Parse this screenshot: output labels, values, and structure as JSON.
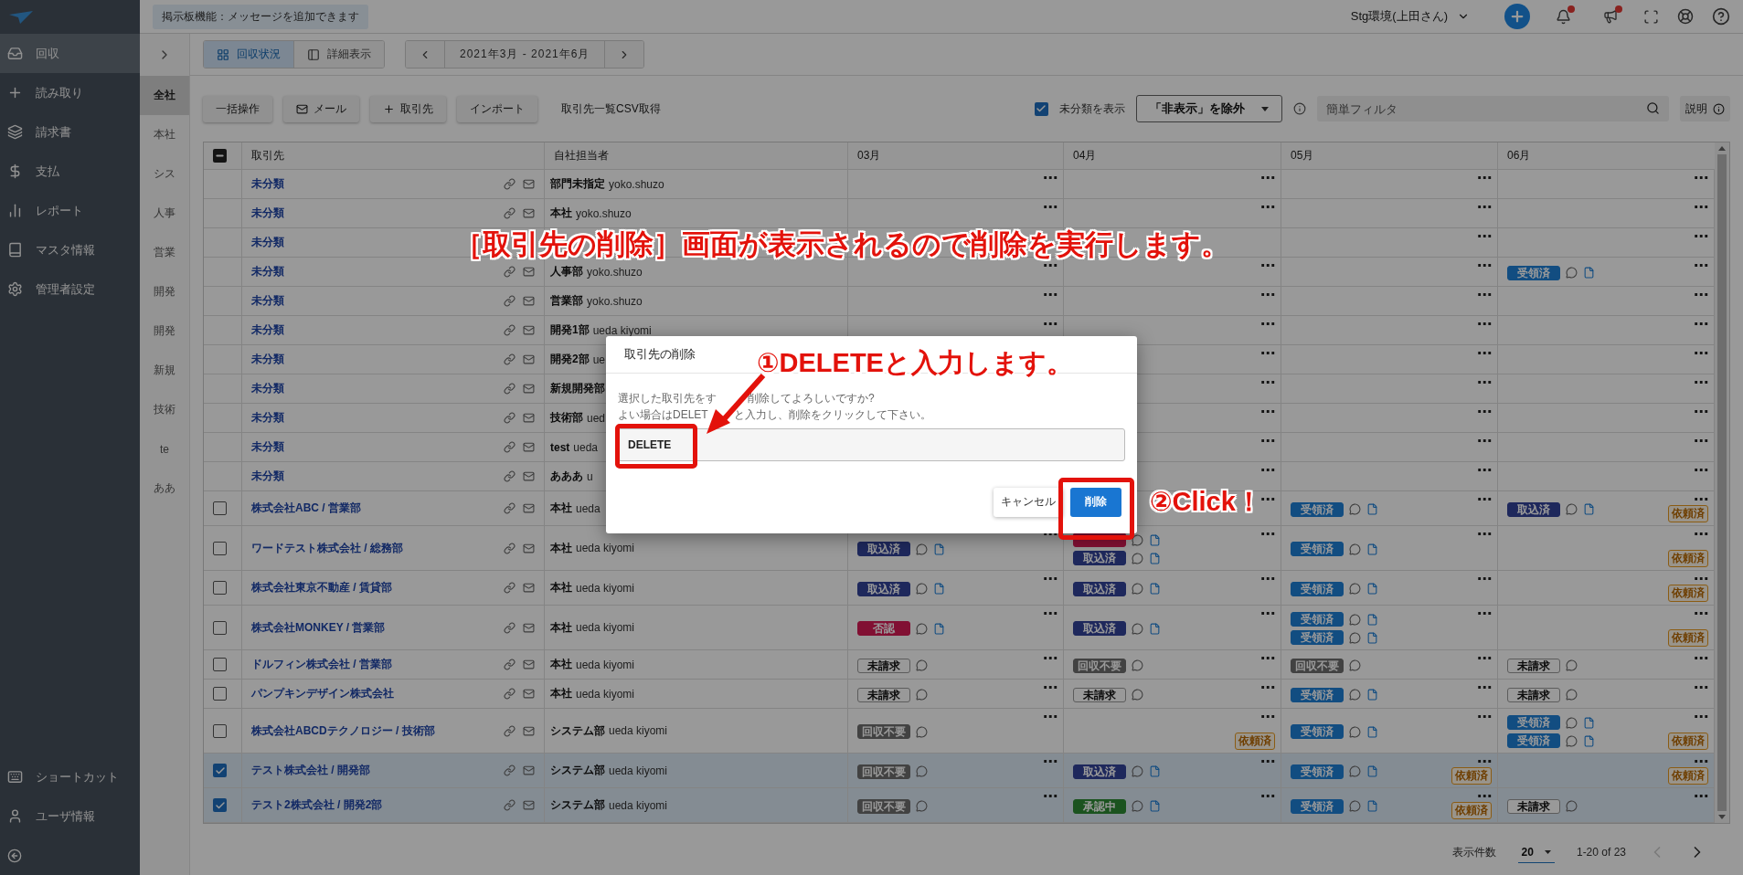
{
  "sidebar": {
    "items": [
      {
        "label": "回収",
        "selected": true
      },
      {
        "label": "読み取り",
        "selected": false
      },
      {
        "label": "請求書",
        "selected": false
      },
      {
        "label": "支払",
        "selected": false
      },
      {
        "label": "レポート",
        "selected": false
      },
      {
        "label": "マスタ情報",
        "selected": false
      },
      {
        "label": "管理者設定",
        "selected": false
      }
    ],
    "bottom_items": [
      "ショートカット",
      "ユーザ情報"
    ]
  },
  "top_bar": {
    "notice": "掲示板機能：メッセージを追加できます",
    "environment": "Stg環境(上田さん)",
    "notifications_unread": true,
    "announcements_unread": true
  },
  "view_tabs": [
    {
      "label": "回収状況",
      "selected": true
    },
    {
      "label": "詳細表示",
      "selected": false
    }
  ],
  "period": "2021年3月 - 2021年6月",
  "subnav": {
    "items": [
      {
        "label": "全社",
        "selected": true
      },
      {
        "label": "本社",
        "selected": false
      },
      {
        "label": "シス",
        "selected": false
      },
      {
        "label": "人事",
        "selected": false
      },
      {
        "label": "営業",
        "selected": false
      },
      {
        "label": "開発",
        "selected": false
      },
      {
        "label": "開発",
        "selected": false
      },
      {
        "label": "新規",
        "selected": false
      },
      {
        "label": "技術",
        "selected": false
      },
      {
        "label": "te",
        "selected": false
      },
      {
        "label": "ああ",
        "selected": false
      }
    ]
  },
  "actions": [
    "一括操作",
    "メール",
    "取引先",
    "インポート"
  ],
  "csv_link": "取引先一覧CSV取得",
  "show_unclassified": {
    "label": "未分類を表示",
    "checked": true
  },
  "visibility_filter": "「非表示」を除外",
  "filter": {
    "placeholder": "簡単フィルタ"
  },
  "help_button": "説明",
  "table": {
    "header_checkbox": {
      "partial": true
    },
    "columns": [
      "取引先",
      "自社担当者",
      "03月",
      "04月",
      "05月",
      "06月"
    ],
    "rows": [
      {
        "kind": "group",
        "name": "未分類",
        "department": "部門未指定",
        "person": "yoko.shuzo",
        "months": [
          {
            "menu": "⋯"
          },
          {
            "menu": "⋯"
          },
          {
            "menu": "⋯"
          },
          {
            "menu": "⋯"
          }
        ]
      },
      {
        "kind": "group",
        "name": "未分類",
        "department": "本社",
        "person": "yoko.shuzo",
        "months": [
          {
            "menu": "⋯"
          },
          {
            "menu": "⋯"
          },
          {
            "menu": "⋯"
          },
          {
            "menu": "⋯"
          }
        ]
      },
      {
        "kind": "group",
        "name": "未分類",
        "months": [
          {
            "menu": "⋯"
          },
          {
            "menu": "⋯"
          }
        ]
      },
      {
        "kind": "group",
        "name": "未分類",
        "department": "人事部",
        "person": "yoko.shuzo",
        "months": [
          {
            "menu": "⋯"
          },
          {
            "menu": "⋯"
          },
          {
            "menu": "⋯"
          },
          {
            "menu": "⋯",
            "statuses": [
              {
                "label": "受領済",
                "kind": "received"
              }
            ]
          }
        ]
      },
      {
        "kind": "group",
        "name": "未分類",
        "department": "営業部",
        "person": "yoko.shuzo",
        "months": [
          {
            "menu": "⋯"
          },
          {
            "menu": "⋯"
          },
          {
            "menu": "⋯"
          },
          {
            "menu": "⋯"
          }
        ]
      },
      {
        "kind": "group",
        "name": "未分類",
        "department": "開発1部",
        "person": "ueda kiyomi",
        "months": [
          {
            "menu": "⋯"
          },
          {
            "menu": "⋯"
          },
          {
            "menu": "⋯"
          },
          {
            "menu": "⋯"
          }
        ]
      },
      {
        "kind": "group",
        "name": "未分類",
        "department": "開発2部",
        "person": "ue",
        "months": [
          {
            "menu": "⋯"
          },
          {
            "menu": "⋯"
          },
          {
            "menu": "⋯"
          }
        ]
      },
      {
        "kind": "group",
        "name": "未分類",
        "department": "新規開発部",
        "months": [
          {
            "menu": "⋯"
          },
          {
            "menu": "⋯"
          },
          {
            "menu": "⋯"
          }
        ]
      },
      {
        "kind": "group",
        "name": "未分類",
        "department": "技術部",
        "person": "ued",
        "months": [
          {
            "menu": "⋯"
          },
          {
            "menu": "⋯"
          },
          {
            "menu": "⋯"
          }
        ]
      },
      {
        "kind": "group",
        "name": "未分類",
        "department": "test",
        "person": "ueda",
        "months": [
          {
            "menu": "⋯"
          },
          {
            "menu": "⋯"
          },
          {
            "menu": "⋯"
          }
        ]
      },
      {
        "kind": "group",
        "name": "未分類",
        "department": "あああ",
        "person": "u",
        "months": [
          {
            "menu": "⋯"
          },
          {
            "menu": "⋯"
          },
          {
            "menu": "⋯"
          }
        ]
      },
      {
        "kind": "partner",
        "checked": false,
        "name": "株式会社ABC / 営業部",
        "department": "本社",
        "person": "ueda",
        "months": [
          {
            "menu": "⋯"
          },
          {
            "menu": "⋯",
            "statuses": [
              {
                "label": "受領済",
                "kind": "received"
              }
            ]
          },
          {
            "menu": "⋯",
            "statuses": [
              {
                "label": "取込済",
                "kind": "imported"
              }
            ],
            "request_label": "依頼済"
          }
        ]
      },
      {
        "kind": "partner",
        "checked": false,
        "name": "ワードテスト株式会社 / 総務部",
        "department": "本社",
        "person": "ueda kiyomi",
        "months": [
          {
            "menu": "⋯",
            "statuses": [
              {
                "label": "取込済",
                "kind": "imported"
              }
            ]
          },
          {
            "menu": "⋯",
            "statuses": [
              {
                "kind": "rejected"
              },
              {
                "label": "取込済",
                "kind": "imported"
              }
            ]
          },
          {
            "menu": "⋯",
            "statuses": [
              {
                "label": "受領済",
                "kind": "received"
              }
            ]
          },
          {
            "menu": "⋯",
            "request_label": "依頼済"
          }
        ]
      },
      {
        "kind": "partner",
        "checked": false,
        "name": "株式会社東京不動産 / 賃貸部",
        "department": "本社",
        "person": "ueda kiyomi",
        "months": [
          {
            "menu": "⋯",
            "statuses": [
              {
                "label": "取込済",
                "kind": "imported"
              }
            ]
          },
          {
            "menu": "⋯",
            "statuses": [
              {
                "label": "取込済",
                "kind": "imported"
              }
            ]
          },
          {
            "menu": "⋯",
            "statuses": [
              {
                "label": "受領済",
                "kind": "received"
              }
            ]
          },
          {
            "menu": "⋯",
            "request_label": "依頼済"
          }
        ]
      },
      {
        "kind": "partner",
        "checked": false,
        "name": "株式会社MONKEY / 営業部",
        "department": "本社",
        "person": "ueda kiyomi",
        "months": [
          {
            "menu": "⋯",
            "statuses": [
              {
                "label": "否認",
                "kind": "rejected"
              }
            ]
          },
          {
            "menu": "⋯",
            "statuses": [
              {
                "label": "取込済",
                "kind": "imported"
              }
            ]
          },
          {
            "menu": "⋯",
            "statuses": [
              {
                "label": "受領済",
                "kind": "received"
              },
              {
                "label": "受領済",
                "kind": "received"
              }
            ]
          },
          {
            "menu": "⋯",
            "request_label": "依頼済"
          }
        ]
      },
      {
        "kind": "partner",
        "checked": false,
        "name": "ドルフィン株式会社 / 営業部",
        "department": "本社",
        "person": "ueda kiyomi",
        "months": [
          {
            "menu": "⋯",
            "statuses": [
              {
                "label": "未請求",
                "kind": "unbilled"
              }
            ]
          },
          {
            "menu": "⋯",
            "statuses": [
              {
                "label": "回収不要",
                "kind": "unneeded"
              }
            ]
          },
          {
            "menu": "⋯",
            "statuses": [
              {
                "label": "回収不要",
                "kind": "unneeded"
              }
            ]
          },
          {
            "menu": "⋯",
            "statuses": [
              {
                "label": "未請求",
                "kind": "unbilled"
              }
            ]
          }
        ]
      },
      {
        "kind": "partner",
        "checked": false,
        "name": "パンプキンデザイン株式会社",
        "department": "本社",
        "person": "ueda kiyomi",
        "months": [
          {
            "menu": "⋯",
            "statuses": [
              {
                "label": "未請求",
                "kind": "unbilled"
              }
            ]
          },
          {
            "menu": "⋯",
            "statuses": [
              {
                "label": "未請求",
                "kind": "unbilled"
              }
            ]
          },
          {
            "menu": "⋯",
            "statuses": [
              {
                "label": "受領済",
                "kind": "received"
              }
            ]
          },
          {
            "menu": "⋯",
            "statuses": [
              {
                "label": "未請求",
                "kind": "unbilled"
              }
            ]
          }
        ]
      },
      {
        "kind": "partner",
        "checked": false,
        "name": "株式会社ABCDテクノロジー / 技術部",
        "department": "システム部",
        "person": "ueda kiyomi",
        "months": [
          {
            "menu": "⋯",
            "statuses": [
              {
                "label": "回収不要",
                "kind": "unneeded"
              }
            ]
          },
          {
            "menu": "⋯",
            "request_label": "依頼済"
          },
          {
            "menu": "⋯",
            "statuses": [
              {
                "label": "受領済",
                "kind": "received"
              }
            ]
          },
          {
            "menu": "⋯",
            "statuses": [
              {
                "label": "受領済",
                "kind": "received"
              },
              {
                "label": "受領済",
                "kind": "received"
              }
            ],
            "request_label": "依頼済"
          }
        ]
      },
      {
        "kind": "partner",
        "checked": true,
        "name": "テスト株式会社 / 開発部",
        "department": "システム部",
        "person": "ueda kiyomi",
        "months": [
          {
            "menu": "⋯",
            "statuses": [
              {
                "label": "回収不要",
                "kind": "unneeded"
              }
            ]
          },
          {
            "menu": "⋯",
            "statuses": [
              {
                "label": "取込済",
                "kind": "imported"
              }
            ]
          },
          {
            "menu": "⋯",
            "statuses": [
              {
                "label": "受領済",
                "kind": "received"
              }
            ],
            "request_label": "依頼済"
          },
          {
            "menu": "⋯",
            "request_label": "依頼済"
          }
        ]
      },
      {
        "kind": "partner",
        "checked": true,
        "name": "テスト2株式会社 / 開発2部",
        "department": "システム部",
        "person": "ueda kiyomi",
        "months": [
          {
            "menu": "⋯",
            "statuses": [
              {
                "label": "回収不要",
                "kind": "unneeded"
              }
            ]
          },
          {
            "menu": "⋯",
            "statuses": [
              {
                "label": "承認中",
                "kind": "approving"
              }
            ]
          },
          {
            "menu": "⋯",
            "statuses": [
              {
                "label": "受領済",
                "kind": "received"
              }
            ],
            "request_label": "依頼済"
          },
          {
            "menu": "⋯",
            "statuses": [
              {
                "label": "未請求",
                "kind": "unbilled"
              }
            ]
          }
        ]
      }
    ]
  },
  "footer": {
    "page_size_label": "表示件数",
    "page_size": "20",
    "range": "1-20 of 23",
    "prev_disabled": true
  },
  "dialog": {
    "title": "取引先の削除",
    "message": [
      [
        "選択した取引先をす",
        "削除してよろしいですか?"
      ],
      [
        "よい場合はDELET",
        "と入力し、削除をクリックして下さい。"
      ]
    ],
    "input_value": "DELETE",
    "cancel": "キャンセル",
    "confirm": "削除"
  },
  "annotations": {
    "headline": "［取引先の削除］画面が表示されるので削除を実行します。",
    "step_1": "①DELETEと入力します。",
    "step_2": "②Click！"
  }
}
